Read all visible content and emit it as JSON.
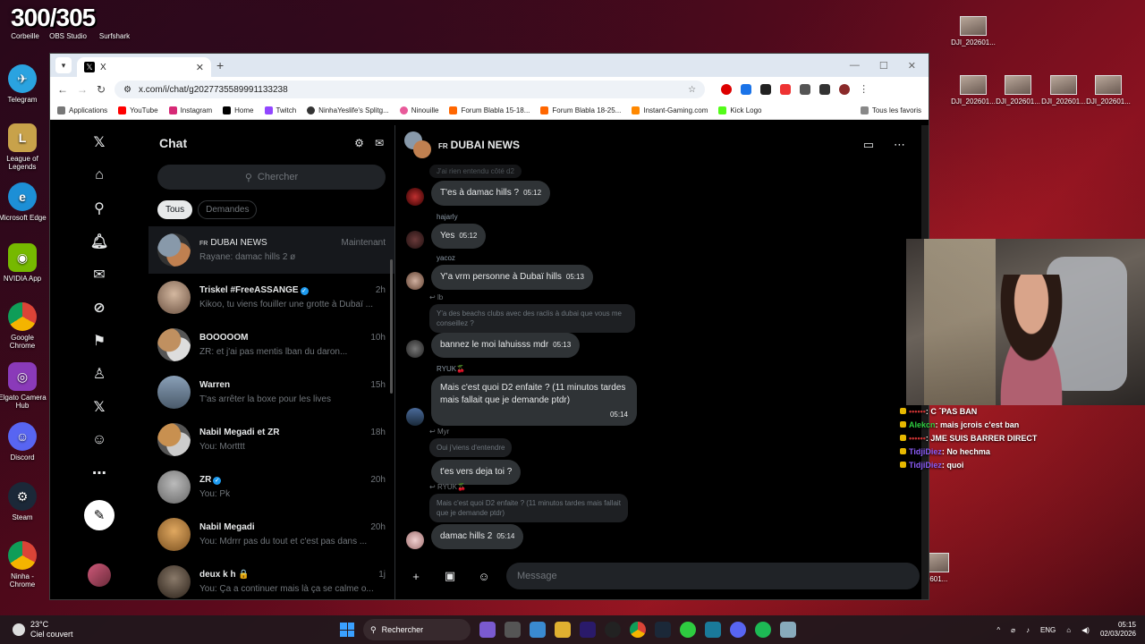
{
  "stream_overlay": {
    "score": "300/305"
  },
  "desktop_icons": [
    {
      "label": "Corbeille",
      "color": "#9aa8b8"
    },
    {
      "label": "OBS Studio",
      "color": "#222"
    },
    {
      "label": "Surfshark",
      "color": "#1aa"
    },
    {
      "label": "Telegram",
      "color": "#2aa3e0"
    },
    {
      "label": "League of Legends",
      "color": "#c8a24a"
    },
    {
      "label": "Microsoft Edge",
      "color": "#1d8fd6"
    },
    {
      "label": "NVIDIA App",
      "color": "#76b900"
    },
    {
      "label": "Google Chrome",
      "color": "#db4437"
    },
    {
      "label": "Elgato Camera Hub",
      "color": "#8a3ab9"
    },
    {
      "label": "Discord",
      "color": "#5865f2"
    },
    {
      "label": "Steam",
      "color": "#1b2838"
    },
    {
      "label": "Ninha - Chrome",
      "color": "#db4437"
    }
  ],
  "desktop_files": [
    "DJI_202601...",
    "DJI_202601...",
    "DJI_202601...",
    "DJI_202601...",
    "DJI_202601...",
    "...601..."
  ],
  "browser": {
    "tab_title": "X",
    "url": "x.com/i/chat/g2027735589991133238",
    "bookmarks": [
      "Applications",
      "YouTube",
      "Instagram",
      "Home",
      "Twitch",
      "NinhaYeslife's Splitg...",
      "Ninouille",
      "Forum Blabla 15-18...",
      "Forum Blabla 18-25...",
      "Instant-Gaming.com",
      "Kick Logo"
    ],
    "bookmarks_right": "Tous les favoris"
  },
  "chat": {
    "title": "Chat",
    "search_placeholder": "Chercher",
    "filters": [
      "Tous",
      "Demandes"
    ],
    "conversations": [
      {
        "flag": "FR",
        "name": "DUBAI NEWS",
        "time": "Maintenant",
        "preview": "Rayane: damac hills 2 ø",
        "color": "#c08050"
      },
      {
        "name": "Triskel #FreeASSANGE",
        "verified": true,
        "time": "2h",
        "preview": "Kikoo, tu viens fouiller une grotte à Dubaï ...",
        "color": "#b8a090"
      },
      {
        "name": "BOOOOOM",
        "time": "10h",
        "preview": "ZR: et j'ai pas mentis lban du daron...",
        "color": "#c09060"
      },
      {
        "name": "Warren",
        "time": "15h",
        "preview": "T'as arrêter la boxe pour les lives",
        "color": "#6a7a8a"
      },
      {
        "name": "Nabil Megadi et ZR",
        "time": "18h",
        "preview": "You: Mortttt",
        "color": "#c89050"
      },
      {
        "name": "ZR",
        "verified": true,
        "time": "20h",
        "preview": "You: Pk",
        "color": "#9a9a9a"
      },
      {
        "name": "Nabil Megadi",
        "time": "20h",
        "preview": "You: Mdrrr pas du tout et c'est pas dans ...",
        "color": "#d49a50"
      },
      {
        "name": "deux k h 🔒",
        "time": "1j",
        "preview": "You: Ça a continuer mais là ça se calme o...",
        "color": "#5a4a3a"
      }
    ]
  },
  "thread": {
    "flag": "FR",
    "title": "DUBAI NEWS",
    "top_faded": "J'ai rien entendu côté d2",
    "messages": [
      {
        "text": "T'es à damac hills ?",
        "time": "05:12"
      },
      {
        "sender": "hajarly",
        "text": "Yes",
        "time": "05:12"
      },
      {
        "sender": "yacoz",
        "text": "Y'a vrm personne à Dubaï hills",
        "time": "05:13"
      },
      {
        "reply_to": "lb",
        "quote": "Y'a des beachs clubs avec des raclis à dubai que vous me conseillez ?",
        "text": "bannez le moi lahuisss mdr",
        "time": "05:13"
      },
      {
        "sender": "RYUK🍒",
        "text": "Mais c'est quoi D2 enfaite ? (11 minutos tardes mais fallait que je demande ptdr)",
        "time": "05:14"
      },
      {
        "reply_to": "Myr",
        "quote": "Oui j'viens d'entendre",
        "text": "t'es vers deja toi ?"
      },
      {
        "reply_to": "RYUK🍒",
        "quote": "Mais c'est quoi D2 enfaite ? (11 minutos tardes mais fallait que je demande ptdr)",
        "text": "damac hills 2",
        "time": "05:14"
      }
    ],
    "input_placeholder": "Message"
  },
  "twitch_chat": [
    {
      "user": "••••••",
      "msg": "C ˆPAS BAN"
    },
    {
      "user": "Alekcn",
      "msg": "mais jcrois c'est ban"
    },
    {
      "user": "••••••",
      "msg": "JME SUIS BARRER DIRECT"
    },
    {
      "user": "TidjiDiez",
      "msg": "No hechma"
    },
    {
      "user": "TidjiDiez",
      "msg": "quoi"
    }
  ],
  "taskbar": {
    "weather_temp": "23°C",
    "weather_desc": "Ciel couvert",
    "search_label": "Rechercher",
    "lang": "ENG",
    "time": "05:15",
    "date": "02/03/2026"
  }
}
